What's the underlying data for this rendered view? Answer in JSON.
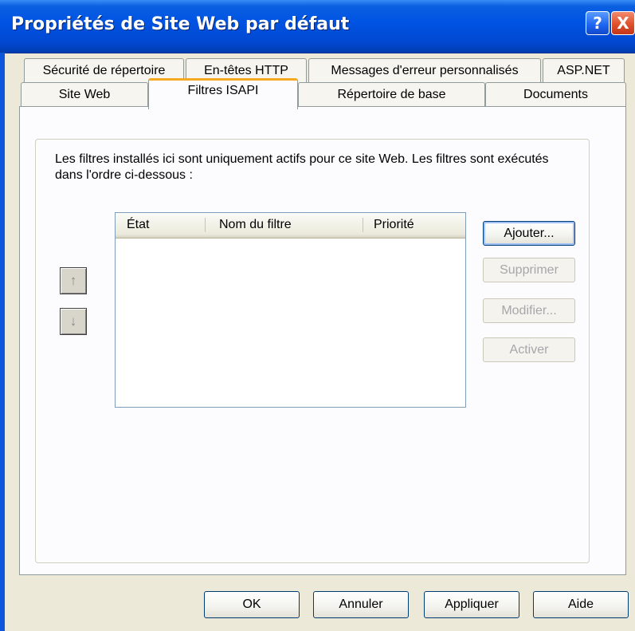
{
  "window": {
    "title": "Propriétés de Site Web par défaut",
    "help_glyph": "?",
    "close_glyph": "X"
  },
  "tabs": {
    "row1": [
      "Sécurité de répertoire",
      "En-têtes HTTP",
      "Messages d'erreur personnalisés",
      "ASP.NET"
    ],
    "row2": [
      "Site Web",
      "Filtres ISAPI",
      "Répertoire de base",
      "Documents"
    ],
    "active": "Filtres ISAPI"
  },
  "isapi": {
    "description": "Les filtres installés ici sont uniquement actifs pour ce site Web. Les filtres sont exécutés dans l'ordre ci-dessous :",
    "columns": [
      "État",
      "Nom du filtre",
      "Priorité"
    ],
    "rows": [],
    "move_up_glyph": "↑",
    "move_down_glyph": "↓",
    "buttons": {
      "add": "Ajouter...",
      "remove": "Supprimer",
      "edit": "Modifier...",
      "enable": "Activer"
    }
  },
  "footer": {
    "ok": "OK",
    "cancel": "Annuler",
    "apply": "Appliquer",
    "help": "Aide"
  },
  "colors": {
    "titlebar": "#0054e3",
    "dialog_bg": "#ece9d8",
    "active_tab_accent": "#f6a821"
  }
}
